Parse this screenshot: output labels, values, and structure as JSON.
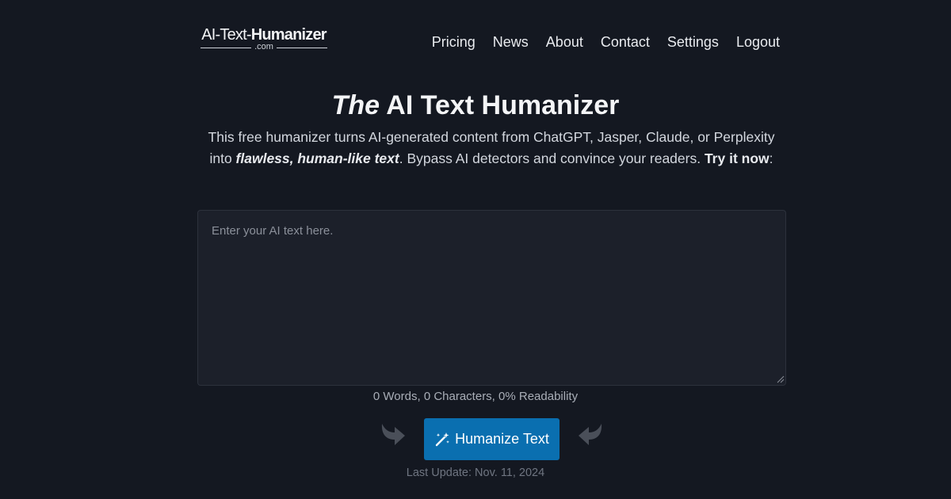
{
  "logo": {
    "part_light": "AI-Text-",
    "part_bold": "Humanizer",
    "sub": ".com"
  },
  "nav": {
    "items": [
      {
        "label": "Pricing"
      },
      {
        "label": "News"
      },
      {
        "label": "About"
      },
      {
        "label": "Contact"
      },
      {
        "label": "Settings"
      },
      {
        "label": "Logout"
      }
    ]
  },
  "hero": {
    "title_italic": "The",
    "title_rest": " AI Text Humanizer",
    "desc_line1": "This free humanizer turns AI-generated content from ChatGPT, Jasper, Claude, or Perplexity",
    "desc_into": "into ",
    "desc_emphasis": "flawless, human-like text",
    "desc_middle": ". Bypass AI detectors and convince your readers. ",
    "desc_cta": "Try it now",
    "desc_end": ":"
  },
  "editor": {
    "placeholder": "Enter your AI text here.",
    "value": ""
  },
  "stats": {
    "text": "0 Words, 0 Characters, 0% Readability"
  },
  "action": {
    "button_label": "Humanize Text",
    "icon": "magic-wand-icon"
  },
  "footer": {
    "last_update_label": "Last Update: ",
    "last_update_date": "Nov. 11, 2024"
  },
  "colors": {
    "background": "#141821",
    "editor_bg": "#1c202a",
    "button": "#0a6fb0",
    "arrow": "#4a4f59"
  }
}
